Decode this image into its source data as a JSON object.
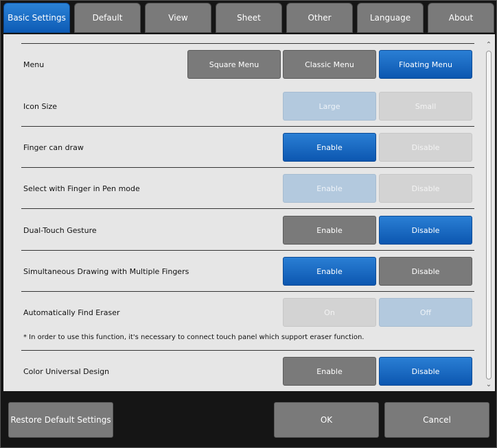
{
  "tabs": [
    "Basic Settings",
    "Default",
    "View",
    "Sheet",
    "Other",
    "Language",
    "About"
  ],
  "active_tab": "Basic Settings",
  "settings": {
    "menu": {
      "label": "Menu",
      "options": [
        "Square Menu",
        "Classic Menu",
        "Floating Menu"
      ],
      "selected": "Floating Menu"
    },
    "icon_size": {
      "label": "Icon Size",
      "options": [
        "Large",
        "Small"
      ],
      "selected": "Large",
      "enabled": false
    },
    "finger_draw": {
      "label": "Finger can draw",
      "options": [
        "Enable",
        "Disable"
      ],
      "selected": "Enable"
    },
    "select_finger": {
      "label": "Select with Finger in Pen mode",
      "options": [
        "Enable",
        "Disable"
      ],
      "selected": "Enable",
      "enabled": false
    },
    "dual_touch": {
      "label": "Dual-Touch Gesture",
      "options": [
        "Enable",
        "Disable"
      ],
      "selected": "Disable"
    },
    "multi_finger": {
      "label": "Simultaneous Drawing with Multiple Fingers",
      "options": [
        "Enable",
        "Disable"
      ],
      "selected": "Enable"
    },
    "find_eraser": {
      "label": "Automatically Find Eraser",
      "options": [
        "On",
        "Off"
      ],
      "selected": "Off",
      "enabled": false
    },
    "color_design": {
      "label": "Color Universal Design",
      "options": [
        "Enable",
        "Disable"
      ],
      "selected": "Disable"
    }
  },
  "note": "* In order to use this function, it's necessary to connect touch panel which support eraser function.",
  "footer": {
    "restore": "Restore Default Settings",
    "ok": "OK",
    "cancel": "Cancel"
  },
  "colors": {
    "selected": "#0c57b0",
    "unselected": "#7a7a7a",
    "disabled_selected": "#b3c9de",
    "disabled_unselected": "#d3d3d3"
  }
}
